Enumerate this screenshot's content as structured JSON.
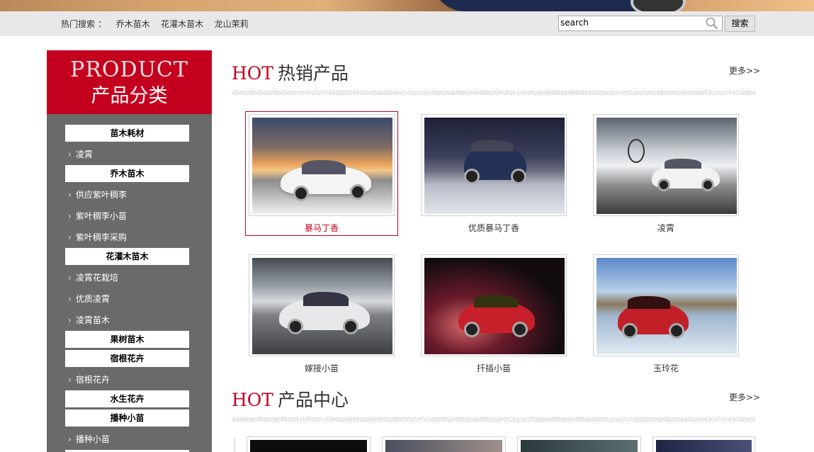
{
  "topbar": {
    "hot_label": "热门搜索 ：",
    "keywords": [
      "乔木苗木",
      "花灌木苗木",
      "龙山茉莉"
    ],
    "search_placeholder": "search",
    "search_button": "搜索"
  },
  "sidebar": {
    "title_en": "PRODUCT",
    "title_cn": "产品分类",
    "categories": [
      {
        "label": "苗木耗材",
        "items": [
          "凌霄"
        ]
      },
      {
        "label": "乔木苗木",
        "items": [
          "供应紫叶稠李",
          "紫叶稠李小苗",
          "紫叶稠李采购"
        ]
      },
      {
        "label": "花灌木苗木",
        "items": [
          "凌霄花栽培",
          "优质凌霄",
          "凌霄苗木"
        ]
      },
      {
        "label": "果树苗木",
        "items": []
      },
      {
        "label": "宿根花卉",
        "items": [
          "宿根花卉"
        ]
      },
      {
        "label": "水生花卉",
        "items": []
      },
      {
        "label": "播种小苗",
        "items": [
          "播种小苗"
        ]
      }
    ]
  },
  "hot_section": {
    "hot": "HOT",
    "title": "热销产品",
    "more": "更多>>",
    "products": [
      {
        "caption": "暴马丁香"
      },
      {
        "caption": "优质暴马丁香"
      },
      {
        "caption": "凌霄"
      },
      {
        "caption": "嫁接小苗"
      },
      {
        "caption": "扦插小苗"
      },
      {
        "caption": "玉玲花"
      }
    ]
  },
  "center_section": {
    "hot": "HOT",
    "title": "产品中心",
    "more": "更多>>"
  },
  "colors": {
    "brand_red": "#c4001f",
    "sidebar_gray": "#6a6a6a"
  }
}
